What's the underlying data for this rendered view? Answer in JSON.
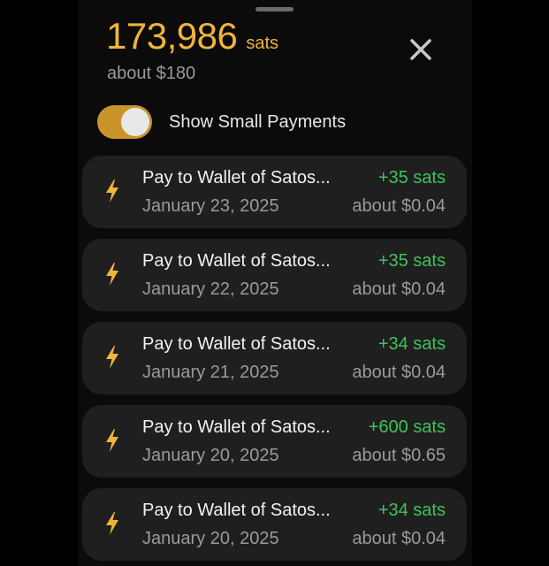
{
  "header": {
    "balance_amount": "173,986",
    "balance_unit": "sats",
    "fiat_value": "about $180",
    "close_icon": "close-icon"
  },
  "toggle": {
    "label": "Show Small Payments",
    "state": "on"
  },
  "colors": {
    "accent": "#f0b43c",
    "toggle_on": "#c9952a",
    "positive": "#3dc45a",
    "card": "#1f1f1f"
  },
  "payments": [
    {
      "icon": "lightning-icon",
      "title": "Pay to Wallet of Satos...",
      "date": "January 23, 2025",
      "sats": "+35 sats",
      "usd": "about $0.04"
    },
    {
      "icon": "lightning-icon",
      "title": "Pay to Wallet of Satos...",
      "date": "January 22, 2025",
      "sats": "+35 sats",
      "usd": "about $0.04"
    },
    {
      "icon": "lightning-icon",
      "title": "Pay to Wallet of Satos...",
      "date": "January 21, 2025",
      "sats": "+34 sats",
      "usd": "about $0.04"
    },
    {
      "icon": "lightning-icon",
      "title": "Pay to Wallet of Satos...",
      "date": "January 20, 2025",
      "sats": "+600 sats",
      "usd": "about $0.65"
    },
    {
      "icon": "lightning-icon",
      "title": "Pay to Wallet of Satos...",
      "date": "January 20, 2025",
      "sats": "+34 sats",
      "usd": "about $0.04"
    }
  ]
}
